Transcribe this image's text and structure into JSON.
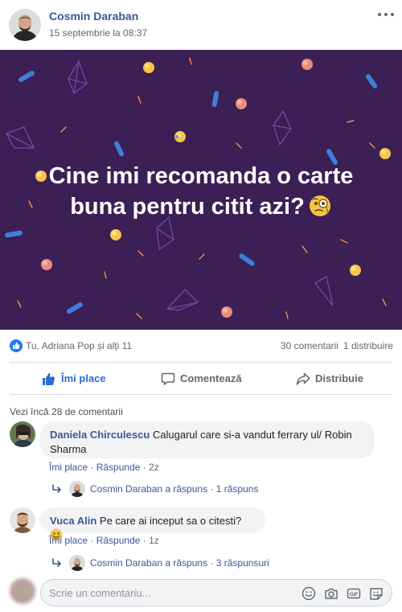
{
  "post": {
    "author": "Cosmin Daraban",
    "timestamp": "15 septembrie la 08:37",
    "text_line1": "Cine imi recomanda o carte",
    "text_line2": "buna pentru citit azi?",
    "emoji": "monocle-face",
    "background_color": "#3b1f55"
  },
  "stats": {
    "reactors": "Tu, Adriana Pop și alți 11",
    "comments": "30 comentarii",
    "shares": "1 distribuire"
  },
  "actions": {
    "like": "Îmi place",
    "comment": "Comentează",
    "share": "Distribuie"
  },
  "comments_section": {
    "more": "Vezi încă 28 de comentarii",
    "items": [
      {
        "author": "Daniela Chirculescu",
        "text": "Calugarul care si-a vandut ferrary ul/ Robin Sharma",
        "like": "Îmi place",
        "reply": "Răspunde",
        "time": "2z",
        "reply_summary": {
          "replier": "Cosmin Daraban a răspuns",
          "count": "1 răspuns"
        }
      },
      {
        "author": "Vuca Alin",
        "text": "Pe care ai inceput sa o citesti?",
        "like": "Îmi place",
        "reply": "Răspunde",
        "time": "1z",
        "reply_summary": {
          "replier": "Cosmin Daraban a răspuns",
          "count": "3 răspunsuri"
        }
      }
    ]
  },
  "composer": {
    "placeholder": "Scrie un comentariu...",
    "icons": [
      "emoji-icon",
      "camera-icon",
      "gif-icon",
      "sticker-icon"
    ]
  },
  "colors": {
    "link_blue": "#385898",
    "facebook_blue": "#2078f4",
    "muted_gray": "#606770"
  }
}
